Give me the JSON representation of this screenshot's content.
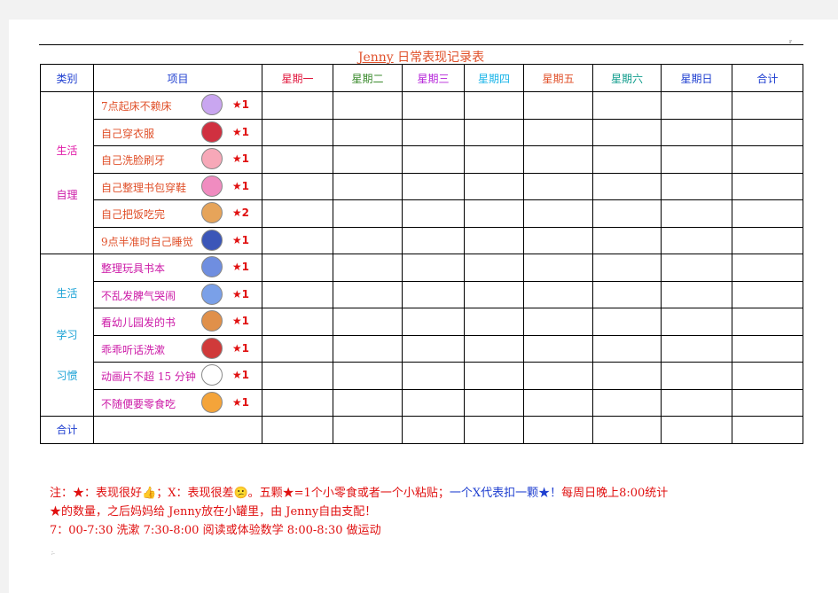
{
  "page_mark": "r",
  "title_en": "Jenny",
  "title_zh": " 日常表现记录表",
  "headers": {
    "category": "类别",
    "item": "项目",
    "mon": "星期一",
    "tue": "星期二",
    "wed": "星期三",
    "thu": "星期四",
    "fri": "星期五",
    "sat": "星期六",
    "sun": "星期日",
    "total": "合计"
  },
  "header_colors": {
    "category": "#1f3fd0",
    "item": "#1f3fd0",
    "mon": "#e0163c",
    "tue": "#3a8a2c",
    "wed": "#b523d9",
    "thu": "#19b4e8",
    "fri": "#e0502a",
    "sat": "#0f9c8c",
    "sun": "#1f3fd0",
    "total": "#1f3fd0"
  },
  "group1": {
    "line1": "生活",
    "line2": "自理",
    "color1": "#e11ca8",
    "color2": "#cc1aa7"
  },
  "group2": {
    "line1": "生活",
    "line2": "学习",
    "line3": "习惯",
    "color": "#1aa2d6"
  },
  "items_group1": [
    {
      "label": "7点起床不赖床",
      "stars": "★1",
      "icon": "girl-sleeping-icon",
      "color": "#e0502a"
    },
    {
      "label": "自己穿衣服",
      "stars": "★1",
      "icon": "girl-dressing-icon",
      "color": "#e0502a"
    },
    {
      "label": "自己洗脸刷牙",
      "stars": "★1",
      "icon": "girl-washing-icon",
      "color": "#e0502a"
    },
    {
      "label": "自己整理书包穿鞋",
      "stars": "★1",
      "icon": "shoe-icon",
      "color": "#e0502a"
    },
    {
      "label": "自己把饭吃完",
      "stars": "★2",
      "icon": "rice-bowl-icon",
      "color": "#e0502a"
    },
    {
      "label": "9点半准时自己睡觉",
      "stars": "★1",
      "icon": "moon-girl-icon",
      "color": "#e0502a"
    }
  ],
  "items_group2": [
    {
      "label": "整理玩具书本",
      "stars": "★1",
      "icon": "girl-tidying-icon",
      "color": "#cc1aa7"
    },
    {
      "label": "不乱发脾气哭闹",
      "stars": "★1",
      "icon": "crying-face-icon",
      "color": "#cc1aa7"
    },
    {
      "label": "看幼儿园发的书",
      "stars": "★1",
      "icon": "boy-reading-icon",
      "color": "#cc1aa7"
    },
    {
      "label": "乖乖听话洗漱",
      "stars": "★1",
      "icon": "girl-red-hat-icon",
      "color": "#cc1aa7"
    },
    {
      "label": "动画片不超 15 分钟",
      "stars": "★1",
      "icon": "cat-face-icon",
      "color": "#cc1aa7"
    },
    {
      "label": "不随便要零食吃",
      "stars": "★1",
      "icon": "cake-icon",
      "color": "#cc1aa7"
    }
  ],
  "footer_total": "合计",
  "notes": {
    "line1_a": "注：★：表现很好",
    "line1_b": "；X：表现很差",
    "line1_c": "。五颗★=1个小零食或者一个小粘贴；",
    "line1_d": "一个X代表扣一颗★！",
    "line1_e": "每周日晚上8:00统计",
    "line2": "★的数量，之后妈妈给 Jenny放在小罐里，由 Jenny自由支配！",
    "line3": "7：00-7:30  洗漱   7:30-8:00 阅读或体验数学  8:00-8:30 做运动",
    "color_red": "#e01010",
    "color_blue": "#1f3fd0",
    "color_black": "#111111"
  },
  "thumbs_up_icon": "thumbs-up-icon",
  "sad_face_icon": "sad-face-icon"
}
